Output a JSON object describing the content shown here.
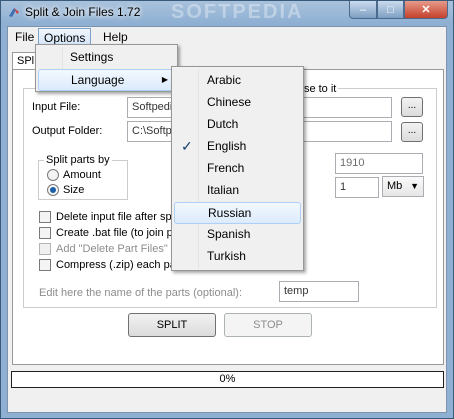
{
  "window": {
    "title": "Split & Join Files 1.72",
    "watermark": "SOFTPEDIA"
  },
  "caption_buttons": {
    "minimize": "–",
    "maximize": "□",
    "close": "✕"
  },
  "menubar": {
    "file": "File",
    "options": "Options",
    "help": "Help"
  },
  "options_menu": {
    "settings": "Settings",
    "language": "Language",
    "submenu_arrow": "▶"
  },
  "language_menu": {
    "items": [
      "Arabic",
      "Chinese",
      "Dutch",
      "English",
      "French",
      "Italian",
      "Russian",
      "Spanish",
      "Turkish"
    ],
    "checked": "English",
    "hovered": "Russian",
    "check_glyph": "✓"
  },
  "tab": {
    "label": "SPl"
  },
  "group": {
    "caption_tail": "wse to it"
  },
  "form": {
    "input_file_label": "Input File:",
    "input_file_value": "Softpedi",
    "output_folder_label": "Output Folder:",
    "output_folder_value": "C:\\Softp",
    "browse_label": "...",
    "split_by_label": "Split parts by",
    "amount_label": "Amount",
    "size_label": "Size",
    "amount_value": "1910",
    "size_value": "1",
    "unit_value": "Mb",
    "unit_arrow": "▼",
    "delete_input_label": "Delete input file after spli",
    "create_bat_label": "Create .bat file (to join pa",
    "add_delete_label": "Add \"Delete Part Files\" o",
    "compress_label": "Compress (.zip) each par",
    "parts_name_label": "Edit here the name of the parts (optional):",
    "parts_name_value": "temp"
  },
  "buttons": {
    "split": "SPLIT",
    "stop": "STOP"
  },
  "progress": {
    "text": "0%",
    "value": 0
  }
}
